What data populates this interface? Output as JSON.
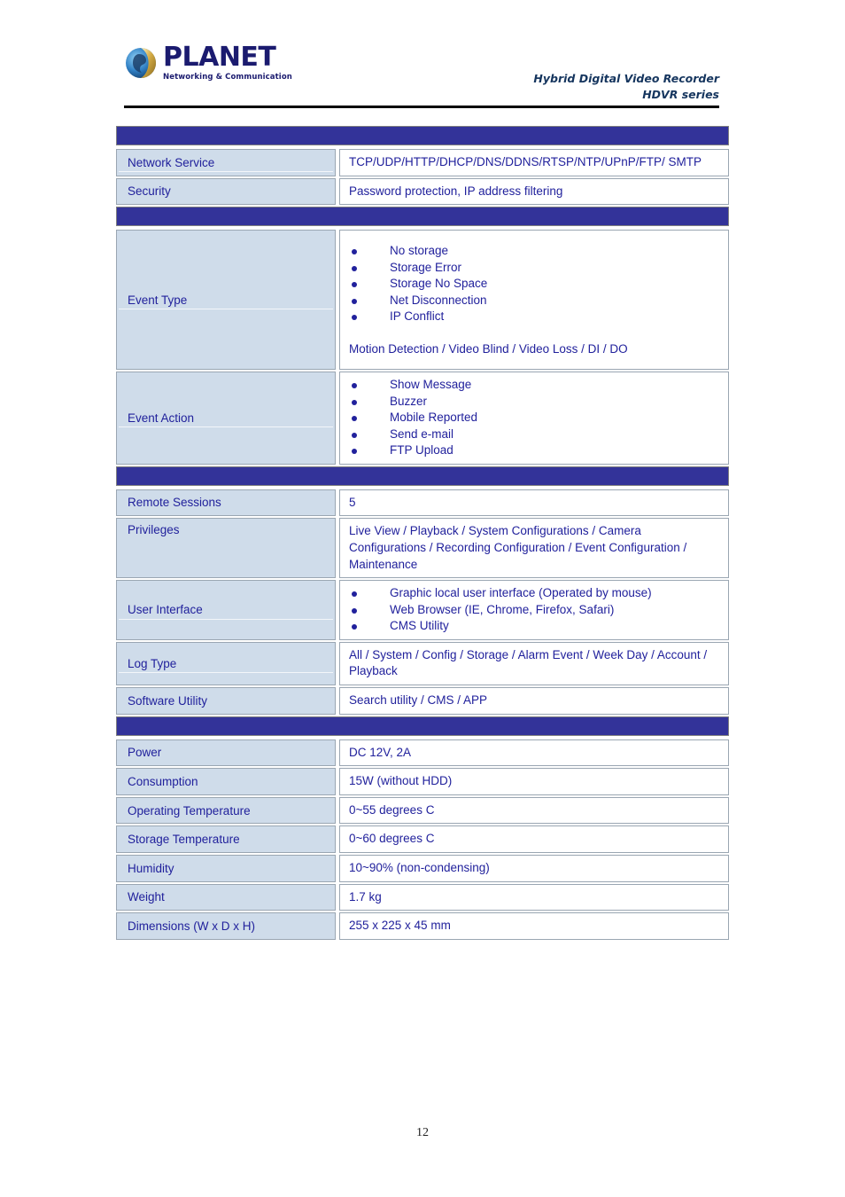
{
  "header": {
    "logo_word": "PLANET",
    "logo_tagline": "Networking & Communication",
    "title_line1": "Hybrid Digital Video Recorder",
    "title_line2": "HDVR series"
  },
  "colors": {
    "band_blue": "#333399",
    "label_fill": "#cfdcea",
    "text_blue": "#21219c",
    "header_navy": "#15355e",
    "rule_black": "#000000"
  },
  "page": {
    "number": "12"
  },
  "sections": [
    {
      "band_label": "",
      "rows": [
        {
          "label": "Network Service",
          "value": "TCP/UDP/HTTP/DHCP/DNS/DDNS/RTSP/NTP/UPnP/FTP/ SMTP"
        },
        {
          "label": "Security",
          "value": "Password protection, IP address filtering"
        }
      ]
    },
    {
      "band_label": "",
      "rows": [
        {
          "label": "Event Type",
          "bullets": [
            "No storage",
            "Storage Error",
            "Storage No Space",
            "Net Disconnection",
            "IP Conflict"
          ],
          "note": "Motion Detection / Video Blind / Video Loss / DI / DO"
        },
        {
          "label": "Event Action",
          "bullets": [
            "Show Message",
            "Buzzer",
            "Mobile Reported",
            "Send e-mail",
            "FTP Upload"
          ]
        }
      ]
    },
    {
      "band_label": "",
      "rows": [
        {
          "label": "Remote Sessions",
          "value": "5"
        },
        {
          "label": "Privileges",
          "value": "Live View / Playback / System Configurations / Camera Configurations / Recording Configuration / Event Configuration / Maintenance"
        },
        {
          "label": "User Interface",
          "bullets": [
            "Graphic local user interface (Operated by mouse)",
            "Web Browser (IE, Chrome, Firefox, Safari)",
            "CMS Utility"
          ]
        },
        {
          "label": "Log Type",
          "value": "All / System / Config / Storage / Alarm Event / Week Day / Account / Playback"
        },
        {
          "label": "Software Utility",
          "value": "Search utility / CMS / APP"
        }
      ]
    },
    {
      "band_label": "",
      "rows": [
        {
          "label": "Power",
          "value": "DC 12V, 2A"
        },
        {
          "label": "Consumption",
          "value": "15W (without HDD)"
        },
        {
          "label": "Operating Temperature",
          "value": "0~55 degrees C"
        },
        {
          "label": "Storage Temperature",
          "value": "0~60 degrees C"
        },
        {
          "label": "Humidity",
          "value": "10~90% (non-condensing)"
        },
        {
          "label": "Weight",
          "value": "1.7 kg"
        },
        {
          "label": "Dimensions (W x D x H)",
          "value": "255 x 225 x 45 mm"
        }
      ]
    }
  ]
}
